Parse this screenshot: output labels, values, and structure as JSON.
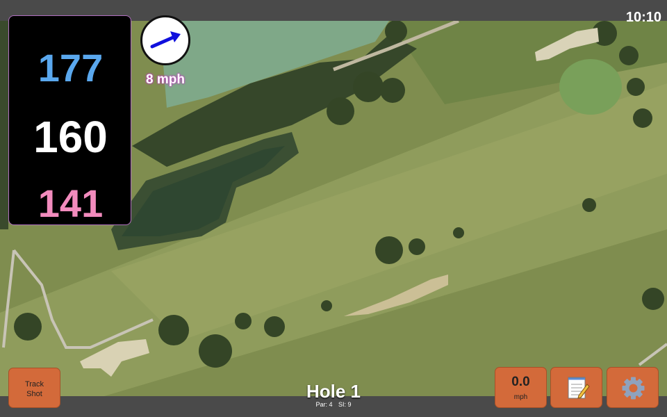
{
  "status": {
    "time": "10:10"
  },
  "distances": {
    "back": "177",
    "middle": "160",
    "front": "141"
  },
  "wind": {
    "speed": "8 mph",
    "icon": "wind-arrow-icon"
  },
  "hole": {
    "title": "Hole 1",
    "par": "Par: 4",
    "stroke_index": "SI: 9"
  },
  "buttons": {
    "track_shot_line1": "Track",
    "track_shot_line2": "Shot",
    "speed_value": "0.0",
    "speed_unit": "mph",
    "notes_icon": "notepad-icon",
    "settings_icon": "gear-icon"
  },
  "colors": {
    "back": "#5aa8ee",
    "middle": "#ffffff",
    "front": "#f28bbd",
    "button": "#d36a3a"
  }
}
